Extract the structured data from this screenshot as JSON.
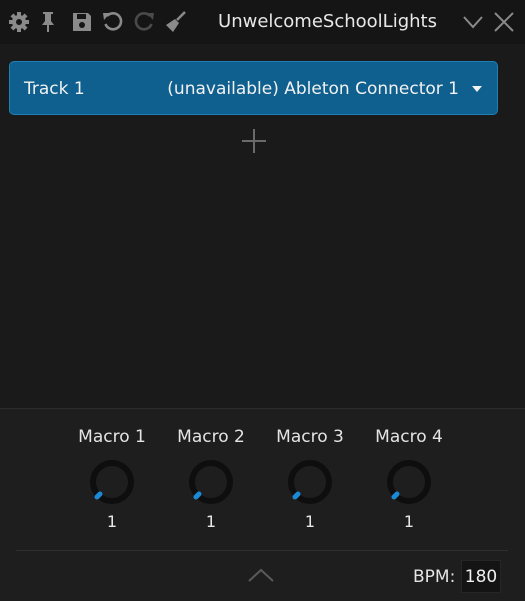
{
  "window": {
    "title": "UnwelcomeSchoolLights"
  },
  "toolbar": {
    "icons": [
      "gear-icon",
      "pin-icon",
      "save-icon",
      "undo-icon",
      "redo-icon",
      "broom-icon"
    ],
    "right_icons": [
      "chevron-down-icon",
      "close-icon"
    ]
  },
  "tracks": [
    {
      "name": "Track 1",
      "device": "(unavailable) Ableton Connector 1"
    }
  ],
  "accent_color": "#0f5f8f",
  "macros": [
    {
      "label": "Macro 1",
      "value": "1"
    },
    {
      "label": "Macro 2",
      "value": "1"
    },
    {
      "label": "Macro 3",
      "value": "1"
    },
    {
      "label": "Macro 4",
      "value": "1"
    }
  ],
  "bpm": {
    "label": "BPM:",
    "value": "180"
  }
}
